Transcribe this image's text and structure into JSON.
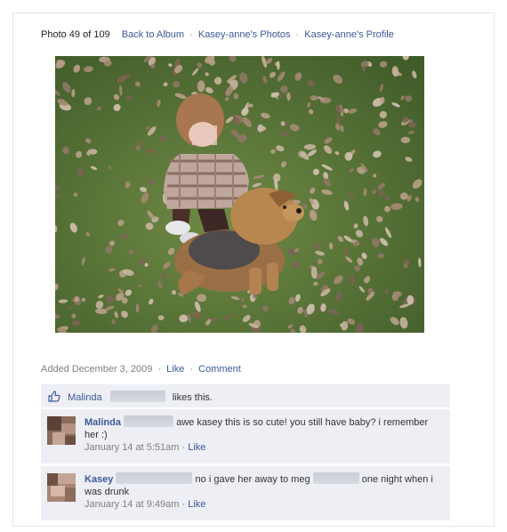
{
  "header": {
    "photo_count": "Photo 49 of 109",
    "links": [
      "Back to Album",
      "Kasey-anne's Photos",
      "Kasey-anne's Profile"
    ],
    "separator": "·"
  },
  "photo": {
    "alt": "toddler and terrier puppy on grass with autumn leaves"
  },
  "meta": {
    "added": "Added December 3, 2009",
    "like": "Like",
    "comment": "Comment",
    "separator": "·"
  },
  "likes": {
    "icon": "thumbs-up-icon",
    "name": "Malinda",
    "text": "likes this."
  },
  "comments": [
    {
      "name": "Malinda",
      "text": "awe kasey this is so cute! you still have baby? i remember her :)",
      "time": "January 14 at 5:51am",
      "like": "Like"
    },
    {
      "name": "Kasey",
      "text_a": "no i gave her away to meg",
      "text_b": "one night when i was drunk",
      "time": "January 14 at 9:49am",
      "like": "Like"
    }
  ],
  "colors": {
    "link": "#3b5998",
    "comment_bg": "#edeff4",
    "muted": "#808080"
  }
}
